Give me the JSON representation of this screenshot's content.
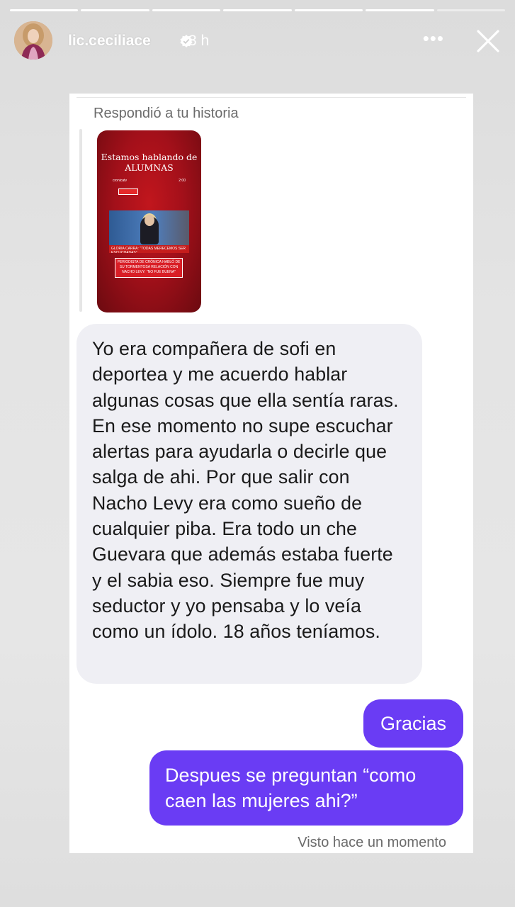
{
  "story": {
    "progress_total": 7,
    "progress_done": 6,
    "username": "lic.ceciliace",
    "time": "3 h",
    "more_icon": "more-dots-icon",
    "close_icon": "close-icon"
  },
  "card": {
    "replied_label": "Respondió a tu historia",
    "thumbnail": {
      "title_line1": "Estamos hablando de",
      "title_line2": "ALUMNAS",
      "source": "cronicatv",
      "duration": "2:00",
      "banner": "GLORIA CARRA: \"TODAS MERECEMOS SER ESCUCHADAS\"",
      "caption": "PERIODISTA DE CRÓNICA HABLÓ DE SU TORMENTOSA RELACIÓN CON NACHO LEVY: \"NO FUE BUENA\""
    },
    "messages": {
      "incoming": "Yo era compañera de sofi en deportea y me acuerdo hablar algunas cosas que ella sentía raras. En ese momento no supe escuchar alertas para ayudarla o decirle que salga de ahi. Por que salir con Nacho Levy era como sueño de cualquier piba. Era todo un che Guevara que además estaba fuerte y el sabia eso. Siempre fue muy seductor y yo pensaba y lo veía como un ídolo. 18 años teníamos.",
      "outgoing_1": "Gracias",
      "outgoing_2": "Despues se preguntan “como caen las mujeres ahi?”"
    },
    "seen_label": "Visto hace un momento"
  },
  "colors": {
    "outgoing_bubble": "#6a3cf4",
    "incoming_bubble": "#efeff4",
    "thumb_red": "#b3121b"
  }
}
